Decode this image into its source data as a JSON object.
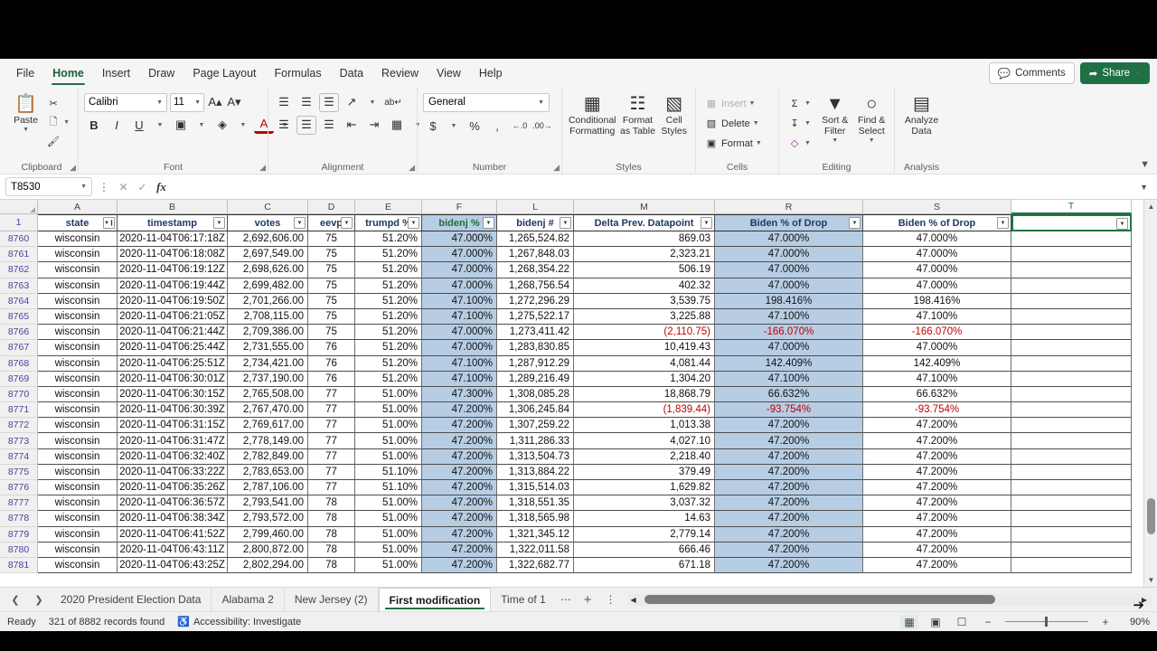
{
  "menu": {
    "items": [
      "File",
      "Home",
      "Insert",
      "Draw",
      "Page Layout",
      "Formulas",
      "Data",
      "Review",
      "View",
      "Help"
    ],
    "active": "Home",
    "comments_label": "Comments",
    "share_label": "Share"
  },
  "ribbon": {
    "groups": [
      {
        "name": "Clipboard",
        "label": "Clipboard"
      },
      {
        "name": "Font",
        "label": "Font"
      },
      {
        "name": "Alignment",
        "label": "Alignment"
      },
      {
        "name": "Number",
        "label": "Number"
      },
      {
        "name": "Styles",
        "label": "Styles"
      },
      {
        "name": "Cells",
        "label": "Cells"
      },
      {
        "name": "Editing",
        "label": "Editing"
      },
      {
        "name": "Analysis",
        "label": "Analysis"
      }
    ],
    "clipboard": {
      "paste": "Paste"
    },
    "font": {
      "family": "Calibri",
      "size": "11"
    },
    "number": {
      "format": "General"
    },
    "styles": {
      "conditional_formatting": "Conditional Formatting",
      "format_as_table": "Format as Table",
      "cell_styles": "Cell Styles"
    },
    "cells": {
      "insert": "Insert",
      "delete": "Delete",
      "format": "Format"
    },
    "editing": {
      "sort_filter": "Sort & Filter",
      "find_select": "Find & Select"
    },
    "analysis": {
      "analyze_data": "Analyze Data"
    }
  },
  "formula_bar": {
    "name_box": "T8530",
    "formula": "",
    "formula_placeholder": ""
  },
  "grid": {
    "columns": [
      {
        "letter": "A",
        "header": "state",
        "width": 88,
        "align": "c",
        "highlight": false,
        "filtered": true,
        "green": false
      },
      {
        "letter": "B",
        "header": "timestamp",
        "width": 122,
        "align": "c",
        "highlight": false,
        "filtered": false,
        "green": false
      },
      {
        "letter": "C",
        "header": "votes",
        "width": 89,
        "align": "r",
        "highlight": false,
        "filtered": false,
        "green": false
      },
      {
        "letter": "D",
        "header": "eevp",
        "width": 52,
        "align": "c",
        "highlight": false,
        "filtered": false,
        "green": false
      },
      {
        "letter": "E",
        "header": "trumpd %",
        "width": 74,
        "align": "r",
        "highlight": false,
        "filtered": false,
        "green": false
      },
      {
        "letter": "F",
        "header": "bidenj %",
        "width": 83,
        "align": "r",
        "highlight": true,
        "filtered": false,
        "green": true
      },
      {
        "letter": "L",
        "header": "bidenj #",
        "width": 85,
        "align": "r",
        "highlight": false,
        "filtered": false,
        "green": false
      },
      {
        "letter": "M",
        "header": "Delta Prev. Datapoint",
        "width": 156,
        "align": "r",
        "highlight": false,
        "filtered": false,
        "green": false
      },
      {
        "letter": "R",
        "header": "Biden % of Drop",
        "width": 164,
        "align": "c",
        "highlight": true,
        "filtered": false,
        "green": false
      },
      {
        "letter": "S",
        "header": "Biden % of Drop",
        "width": 164,
        "align": "c",
        "highlight": false,
        "filtered": false,
        "green": false
      },
      {
        "letter": "T",
        "header": "",
        "width": 133,
        "align": "c",
        "highlight": false,
        "filtered": false,
        "green": false,
        "selected": true
      }
    ],
    "header_row_number": "1",
    "rows": [
      {
        "n": "8760",
        "cells": [
          "wisconsin",
          "2020-11-04T06:17:18Z",
          "2,692,606.00",
          "75",
          "51.20%",
          "47.000%",
          "1,265,524.82",
          "869.03",
          "47.000%",
          "47.000%",
          ""
        ]
      },
      {
        "n": "8761",
        "cells": [
          "wisconsin",
          "2020-11-04T06:18:08Z",
          "2,697,549.00",
          "75",
          "51.20%",
          "47.000%",
          "1,267,848.03",
          "2,323.21",
          "47.000%",
          "47.000%",
          ""
        ]
      },
      {
        "n": "8762",
        "cells": [
          "wisconsin",
          "2020-11-04T06:19:12Z",
          "2,698,626.00",
          "75",
          "51.20%",
          "47.000%",
          "1,268,354.22",
          "506.19",
          "47.000%",
          "47.000%",
          ""
        ]
      },
      {
        "n": "8763",
        "cells": [
          "wisconsin",
          "2020-11-04T06:19:44Z",
          "2,699,482.00",
          "75",
          "51.20%",
          "47.000%",
          "1,268,756.54",
          "402.32",
          "47.000%",
          "47.000%",
          ""
        ]
      },
      {
        "n": "8764",
        "cells": [
          "wisconsin",
          "2020-11-04T06:19:50Z",
          "2,701,266.00",
          "75",
          "51.20%",
          "47.100%",
          "1,272,296.29",
          "3,539.75",
          "198.416%",
          "198.416%",
          ""
        ]
      },
      {
        "n": "8765",
        "cells": [
          "wisconsin",
          "2020-11-04T06:21:05Z",
          "2,708,115.00",
          "75",
          "51.20%",
          "47.100%",
          "1,275,522.17",
          "3,225.88",
          "47.100%",
          "47.100%",
          ""
        ]
      },
      {
        "n": "8766",
        "cells": [
          "wisconsin",
          "2020-11-04T06:21:44Z",
          "2,709,386.00",
          "75",
          "51.20%",
          "47.000%",
          "1,273,411.42",
          "(2,110.75)",
          "-166.070%",
          "-166.070%",
          ""
        ]
      },
      {
        "n": "8767",
        "cells": [
          "wisconsin",
          "2020-11-04T06:25:44Z",
          "2,731,555.00",
          "76",
          "51.20%",
          "47.000%",
          "1,283,830.85",
          "10,419.43",
          "47.000%",
          "47.000%",
          ""
        ]
      },
      {
        "n": "8768",
        "cells": [
          "wisconsin",
          "2020-11-04T06:25:51Z",
          "2,734,421.00",
          "76",
          "51.20%",
          "47.100%",
          "1,287,912.29",
          "4,081.44",
          "142.409%",
          "142.409%",
          ""
        ]
      },
      {
        "n": "8769",
        "cells": [
          "wisconsin",
          "2020-11-04T06:30:01Z",
          "2,737,190.00",
          "76",
          "51.20%",
          "47.100%",
          "1,289,216.49",
          "1,304.20",
          "47.100%",
          "47.100%",
          ""
        ]
      },
      {
        "n": "8770",
        "cells": [
          "wisconsin",
          "2020-11-04T06:30:15Z",
          "2,765,508.00",
          "77",
          "51.00%",
          "47.300%",
          "1,308,085.28",
          "18,868.79",
          "66.632%",
          "66.632%",
          ""
        ]
      },
      {
        "n": "8771",
        "cells": [
          "wisconsin",
          "2020-11-04T06:30:39Z",
          "2,767,470.00",
          "77",
          "51.00%",
          "47.200%",
          "1,306,245.84",
          "(1,839.44)",
          "-93.754%",
          "-93.754%",
          ""
        ]
      },
      {
        "n": "8772",
        "cells": [
          "wisconsin",
          "2020-11-04T06:31:15Z",
          "2,769,617.00",
          "77",
          "51.00%",
          "47.200%",
          "1,307,259.22",
          "1,013.38",
          "47.200%",
          "47.200%",
          ""
        ]
      },
      {
        "n": "8773",
        "cells": [
          "wisconsin",
          "2020-11-04T06:31:47Z",
          "2,778,149.00",
          "77",
          "51.00%",
          "47.200%",
          "1,311,286.33",
          "4,027.10",
          "47.200%",
          "47.200%",
          ""
        ]
      },
      {
        "n": "8774",
        "cells": [
          "wisconsin",
          "2020-11-04T06:32:40Z",
          "2,782,849.00",
          "77",
          "51.00%",
          "47.200%",
          "1,313,504.73",
          "2,218.40",
          "47.200%",
          "47.200%",
          ""
        ]
      },
      {
        "n": "8775",
        "cells": [
          "wisconsin",
          "2020-11-04T06:33:22Z",
          "2,783,653.00",
          "77",
          "51.10%",
          "47.200%",
          "1,313,884.22",
          "379.49",
          "47.200%",
          "47.200%",
          ""
        ]
      },
      {
        "n": "8776",
        "cells": [
          "wisconsin",
          "2020-11-04T06:35:26Z",
          "2,787,106.00",
          "77",
          "51.10%",
          "47.200%",
          "1,315,514.03",
          "1,629.82",
          "47.200%",
          "47.200%",
          ""
        ]
      },
      {
        "n": "8777",
        "cells": [
          "wisconsin",
          "2020-11-04T06:36:57Z",
          "2,793,541.00",
          "78",
          "51.00%",
          "47.200%",
          "1,318,551.35",
          "3,037.32",
          "47.200%",
          "47.200%",
          ""
        ]
      },
      {
        "n": "8778",
        "cells": [
          "wisconsin",
          "2020-11-04T06:38:34Z",
          "2,793,572.00",
          "78",
          "51.00%",
          "47.200%",
          "1,318,565.98",
          "14.63",
          "47.200%",
          "47.200%",
          ""
        ]
      },
      {
        "n": "8779",
        "cells": [
          "wisconsin",
          "2020-11-04T06:41:52Z",
          "2,799,460.00",
          "78",
          "51.00%",
          "47.200%",
          "1,321,345.12",
          "2,779.14",
          "47.200%",
          "47.200%",
          ""
        ]
      },
      {
        "n": "8780",
        "cells": [
          "wisconsin",
          "2020-11-04T06:43:11Z",
          "2,800,872.00",
          "78",
          "51.00%",
          "47.200%",
          "1,322,011.58",
          "666.46",
          "47.200%",
          "47.200%",
          ""
        ]
      },
      {
        "n": "8781",
        "cells": [
          "wisconsin",
          "2020-11-04T06:43:25Z",
          "2,802,294.00",
          "78",
          "51.00%",
          "47.200%",
          "1,322,682.77",
          "671.18",
          "47.200%",
          "47.200%",
          ""
        ]
      }
    ],
    "negative_cells": [
      "(2,110.75)",
      "(1,839.44)"
    ]
  },
  "sheet_tabs": {
    "items": [
      {
        "label": "2020 President Election Data",
        "active": false
      },
      {
        "label": "Alabama 2",
        "active": false
      },
      {
        "label": "New Jersey (2)",
        "active": false
      },
      {
        "label": "First modification",
        "active": true
      },
      {
        "label": "Time of 1",
        "active": false
      }
    ],
    "add_label": "+"
  },
  "status_bar": {
    "state": "Ready",
    "records": "321 of 8882 records found",
    "accessibility": "Accessibility: Investigate",
    "zoom": "90%"
  },
  "colors": {
    "accent_green": "#217346",
    "selection_blue": "#b7cde4",
    "negative_red": "#c00000",
    "header_text": "#1f3864"
  }
}
